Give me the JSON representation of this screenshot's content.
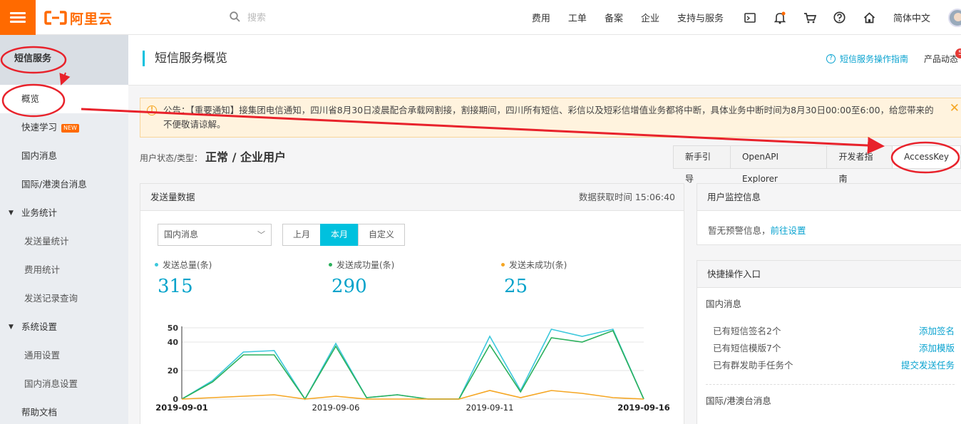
{
  "topbar": {
    "logo_text": "阿里云",
    "search_placeholder": "搜索",
    "nav": [
      "费用",
      "工单",
      "备案",
      "企业",
      "支持与服务"
    ],
    "icons": [
      "terminal-icon",
      "bell-icon",
      "cart-icon",
      "help-icon",
      "home-icon"
    ],
    "language": "简体中文"
  },
  "sidebar": {
    "header": "短信服务",
    "items": [
      {
        "label": "概览"
      },
      {
        "label": "快速学习",
        "badge": "NEW"
      },
      {
        "label": "国内消息"
      },
      {
        "label": "国际/港澳台消息"
      },
      {
        "label": "业务统计"
      },
      {
        "label": "发送量统计"
      },
      {
        "label": "费用统计"
      },
      {
        "label": "发送记录查询"
      },
      {
        "label": "系统设置"
      },
      {
        "label": "通用设置"
      },
      {
        "label": "国内消息设置"
      },
      {
        "label": "帮助文档"
      }
    ]
  },
  "header": {
    "title": "短信服务概览",
    "guide_link": "短信服务操作指南",
    "product_news": "产品动态",
    "news_count": "5"
  },
  "notice": {
    "text": "公告：【重要通知】接集团电信通知，四川省8月30日凌晨配合承载网割接，割接期间，四川所有短信、彩信以及短彩信增值业务都将中断，具体业务中断时间为8月30日00:00至6:00，给您带来的不便敬请谅解。"
  },
  "user_status": {
    "label": "用户状态/类型：",
    "value": "正常 / 企业用户"
  },
  "tabs": [
    "新手引导",
    "OpenAPI Explorer",
    "开发者指南",
    "AccessKey"
  ],
  "send_card": {
    "title": "发送量数据",
    "fetch_time": "数据获取时间 15:06:40",
    "select_value": "国内消息",
    "periods": [
      "上月",
      "本月",
      "自定义"
    ],
    "active_period": "本月",
    "stats": [
      {
        "label": "发送总量(条)",
        "value": "315",
        "color": "#3cc8dc"
      },
      {
        "label": "发送成功量(条)",
        "value": "290",
        "color": "#2bb05c"
      },
      {
        "label": "发送未成功(条)",
        "value": "25",
        "color": "#f5a623"
      }
    ]
  },
  "chart_data": {
    "type": "line",
    "x": [
      "2019-09-01",
      "2019-09-02",
      "2019-09-03",
      "2019-09-04",
      "2019-09-05",
      "2019-09-06",
      "2019-09-07",
      "2019-09-08",
      "2019-09-09",
      "2019-09-10",
      "2019-09-11",
      "2019-09-12",
      "2019-09-13",
      "2019-09-14",
      "2019-09-15",
      "2019-09-16"
    ],
    "xticks": [
      "2019-09-01",
      "2019-09-06",
      "2019-09-11",
      "2019-09-16"
    ],
    "yticks": [
      0,
      20,
      40,
      50
    ],
    "ylim": [
      0,
      50
    ],
    "series": [
      {
        "name": "发送总量(条)",
        "color": "#3cc8dc",
        "values": [
          0,
          13,
          33,
          34,
          0,
          39,
          1,
          3,
          0,
          0,
          44,
          6,
          49,
          44,
          49,
          0
        ]
      },
      {
        "name": "发送成功量(条)",
        "color": "#2bb05c",
        "values": [
          0,
          12,
          31,
          31,
          0,
          37,
          1,
          3,
          0,
          0,
          38,
          5,
          43,
          40,
          48,
          0
        ]
      },
      {
        "name": "发送未成功(条)",
        "color": "#f5a623",
        "values": [
          0,
          1,
          2,
          3,
          0,
          2,
          0,
          0,
          0,
          0,
          6,
          1,
          6,
          4,
          1,
          0
        ]
      }
    ]
  },
  "monitor_card": {
    "title": "用户监控信息",
    "text": "暂无预警信息，",
    "link": "前往设置"
  },
  "quick_card": {
    "title": "快捷操作入口",
    "section1": "国内消息",
    "rows": [
      {
        "label": "已有短信签名2个",
        "action": "添加签名"
      },
      {
        "label": "已有短信模版7个",
        "action": "添加模版"
      },
      {
        "label": "已有群发助手任务个",
        "action": "提交发送任务"
      }
    ],
    "section2": "国际/港澳台消息"
  }
}
